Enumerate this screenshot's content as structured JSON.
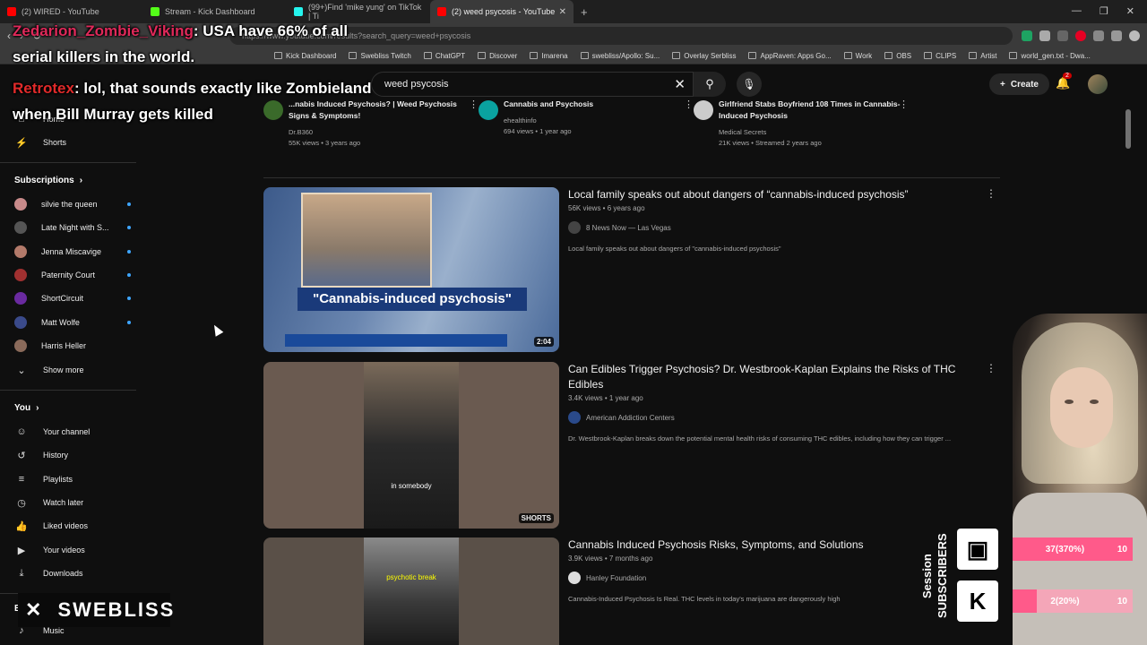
{
  "browser": {
    "tabs": [
      {
        "label": "(2) WIRED - YouTube",
        "color": "#ff0000",
        "active": false
      },
      {
        "label": "Stream - Kick Dashboard",
        "color": "#53fc18",
        "active": false
      },
      {
        "label": "(99+)Find 'mike yung' on TikTok | Ti",
        "color": "#25f4ee",
        "active": false
      },
      {
        "label": "(2) weed psycosis - YouTube",
        "color": "#ff0000",
        "active": true
      }
    ],
    "url": "https://www.youtube.com/results?search_query=weed+psycosis",
    "bookmarks": [
      "Kick Dashboard",
      "Swebliss Twitch",
      "ChatGPT",
      "Discover",
      "Imarena",
      "swebliss/Apollo: Su...",
      "Overlay Serbliss",
      "AppRaven: Apps Go...",
      "Work",
      "OBS",
      "CLIPS",
      "Artist",
      "world_gen.txt - Dwa..."
    ]
  },
  "yt": {
    "search_value": "weed psycosis",
    "create_label": "Create",
    "notif_count": "2"
  },
  "sidebar": {
    "home": "Home",
    "shorts": "Shorts",
    "subscriptions_title": "Subscriptions",
    "subscriptions": [
      {
        "label": "silvie the queen",
        "color": "#c88a8a"
      },
      {
        "label": "Late Night with S...",
        "color": "#555555"
      },
      {
        "label": "Jenna Miscavige",
        "color": "#b37a6a"
      },
      {
        "label": "Paternity Court",
        "color": "#a03030"
      },
      {
        "label": "ShortCircuit",
        "color": "#6a2aa0"
      },
      {
        "label": "Matt Wolfe",
        "color": "#3a4a8a"
      },
      {
        "label": "Harris Heller",
        "color": "#8a6a5a"
      }
    ],
    "show_more": "Show more",
    "you_title": "You",
    "you_items": [
      "Your channel",
      "History",
      "Playlists",
      "Watch later",
      "Liked videos",
      "Your videos",
      "Downloads"
    ],
    "explore_partial": "E",
    "music": "Music"
  },
  "top_cards": [
    {
      "title": "...nabis Induced Psychosis? | Weed Psychosis Signs & Symptoms!",
      "channel": "Dr.B360",
      "meta": "55K views • 3 years ago"
    },
    {
      "title": "Cannabis and Psychosis",
      "channel": "ehealthinfo",
      "meta": "694 views • 1 year ago"
    },
    {
      "title": "Girlfriend Stabs Boyfriend 108 Times in Cannabis-Induced Psychosis",
      "channel": "Medical Secrets",
      "meta": "21K views • Streamed 2 years ago"
    }
  ],
  "videos": [
    {
      "title": "Local family speaks out about dangers of “cannabis-induced psychosis”",
      "meta": "56K views • 6 years ago",
      "channel": "8 News Now — Las Vegas",
      "desc": "Local family speaks out about dangers of \"cannabis-induced psychosis\"",
      "duration": "2:04",
      "thumb_caption": "\"Cannabis-induced psychosis\""
    },
    {
      "title": "Can Edibles Trigger Psychosis? Dr. Westbrook-Kaplan Explains the Risks of THC Edibles",
      "meta": "3.4K views • 1 year ago",
      "channel": "American Addiction Centers",
      "desc": "Dr. Westbrook-Kaplan breaks down the potential mental health risks of consuming THC edibles, including how they can trigger ...",
      "duration": "SHORTS",
      "thumb_caption": "in somebody"
    },
    {
      "title": "Cannabis Induced Psychosis Risks, Symptoms, and Solutions",
      "meta": "3.9K views • 7 months ago",
      "channel": "Hanley Foundation",
      "desc": "Cannabis-Induced Psychosis Is Real. THC levels in today's marijuana are dangerously high",
      "duration": "",
      "thumb_caption": "psychotic break"
    }
  ],
  "overlay": {
    "chat1_name": "Zedarion_Zombie_Viking",
    "chat1_text": ": USA have 66% of all serial killers in the world.",
    "chat2_name": "Retrotex",
    "chat2_text": ": lol, that sounds exactly like Zombieland when Bill Murray gets killed",
    "x_handle": "SWEBLISS",
    "session_label": "Session SUBSCRIBERS",
    "twitch_subs": "37(370%)",
    "twitch_goal": "10",
    "twitch_fill": 1.0,
    "kick_subs": "2(20%)",
    "kick_goal": "10",
    "kick_fill": 0.2
  }
}
